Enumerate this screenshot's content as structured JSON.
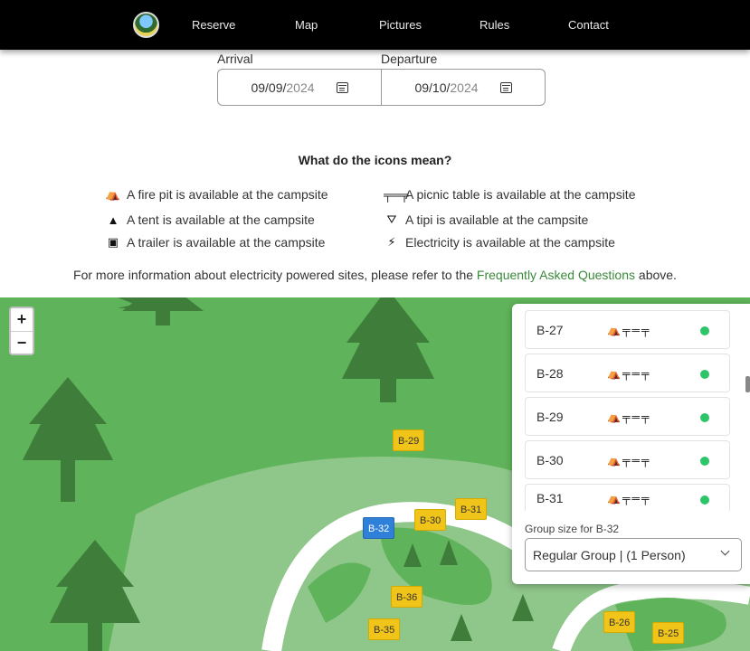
{
  "nav": {
    "items": [
      "Reserve",
      "Map",
      "Pictures",
      "Rules",
      "Contact"
    ]
  },
  "dates": {
    "arrival_label": "Arrival",
    "departure_label": "Departure",
    "arrival_value": "09/09/",
    "arrival_year": "2024",
    "departure_value": "09/10/",
    "departure_year": "2024"
  },
  "legend": {
    "heading": "What do the icons mean?",
    "items": [
      {
        "icon": "fire-pit-icon",
        "text": "A fire pit is available at the campsite"
      },
      {
        "icon": "picnic-table-icon",
        "text": "A picnic table is available at the campsite"
      },
      {
        "icon": "tent-icon",
        "text": "A tent is available at the campsite"
      },
      {
        "icon": "tipi-icon",
        "text": "A tipi is available at the campsite"
      },
      {
        "icon": "trailer-icon",
        "text": "A trailer is available at the campsite"
      },
      {
        "icon": "electricity-icon",
        "text": "Electricity is available at the campsite"
      }
    ]
  },
  "info": {
    "before": "For more information about electricity powered sites, please refer to the ",
    "link": "Frequently Asked Questions",
    "after": " above."
  },
  "map": {
    "zoom_in": "+",
    "zoom_out": "−",
    "sites": [
      "B-29",
      "B-31",
      "B-30",
      "B-32",
      "B-36",
      "B-35",
      "B-26",
      "B-25"
    ],
    "selected_site": "B-32"
  },
  "panel": {
    "sites": [
      {
        "name": "B-27",
        "available": true
      },
      {
        "name": "B-28",
        "available": true
      },
      {
        "name": "B-29",
        "available": true
      },
      {
        "name": "B-30",
        "available": true
      },
      {
        "name": "B-31",
        "available": true
      }
    ],
    "group_label": "Group size for B-32",
    "group_value": "Regular Group | (1 Person)",
    "status_color": "#2ec46a"
  }
}
